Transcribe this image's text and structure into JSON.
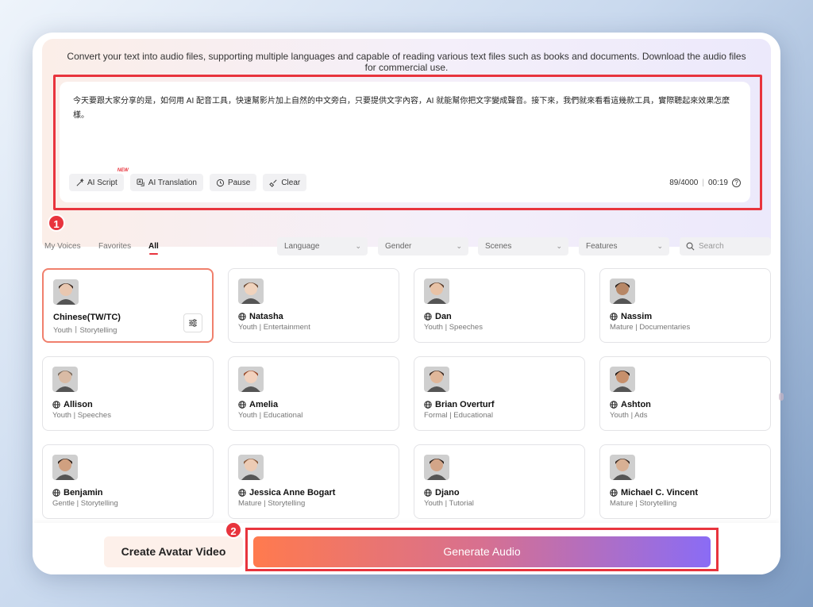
{
  "intro_text": "Convert your text into audio files, supporting multiple languages and capable of reading various text files such as books and documents. Download the audio files for commercial use.",
  "editor": {
    "text": "今天要跟大家分享的是，如何用 AI 配音工具，快速幫影片加上自然的中文旁白，只要提供文字內容，AI 就能幫你把文字變成聲音。接下來，我們就來看看這幾款工具，實際聽起來效果怎麼樣。",
    "tools": [
      {
        "label": "AI Script",
        "icon": "ai-script-icon",
        "badge": "NEW"
      },
      {
        "label": "AI Translation",
        "icon": "translate-icon"
      },
      {
        "label": "Pause",
        "icon": "pause-clock-icon"
      },
      {
        "label": "Clear",
        "icon": "broom-icon"
      }
    ],
    "char_count": "89/4000",
    "duration": "00:19"
  },
  "markers": {
    "one": "1",
    "two": "2"
  },
  "voice_tabs": [
    {
      "label": "My Voices",
      "active": false
    },
    {
      "label": "Favorites",
      "active": false
    },
    {
      "label": "All",
      "active": true
    }
  ],
  "filters": {
    "language": "Language",
    "gender": "Gender",
    "scenes": "Scenes",
    "features": "Features",
    "search_placeholder": "Search"
  },
  "voices": [
    {
      "name": "Chinese(TW/TC)",
      "meta": "Youth丨Storytelling",
      "selected": true,
      "globe": false
    },
    {
      "name": "Natasha",
      "meta": "Youth | Entertainment",
      "selected": false,
      "globe": true
    },
    {
      "name": "Dan",
      "meta": "Youth | Speeches",
      "selected": false,
      "globe": true
    },
    {
      "name": "Nassim",
      "meta": "Mature | Documentaries",
      "selected": false,
      "globe": true
    },
    {
      "name": "Allison",
      "meta": "Youth | Speeches",
      "selected": false,
      "globe": true
    },
    {
      "name": "Amelia",
      "meta": "Youth | Educational",
      "selected": false,
      "globe": true
    },
    {
      "name": "Brian Overturf",
      "meta": "Formal | Educational",
      "selected": false,
      "globe": true
    },
    {
      "name": "Ashton",
      "meta": "Youth | Ads",
      "selected": false,
      "globe": true
    },
    {
      "name": "Benjamin",
      "meta": "Gentle | Storytelling",
      "selected": false,
      "globe": true
    },
    {
      "name": "Jessica Anne Bogart",
      "meta": "Mature | Storytelling",
      "selected": false,
      "globe": true
    },
    {
      "name": "Djano",
      "meta": "Youth | Tutorial",
      "selected": false,
      "globe": true
    },
    {
      "name": "Michael C. Vincent",
      "meta": "Mature | Storytelling",
      "selected": false,
      "globe": true
    }
  ],
  "actions": {
    "create_avatar": "Create Avatar Video",
    "generate_audio": "Generate Audio"
  },
  "colors": {
    "accent_red": "#e8343d",
    "gradient_start": "#ff7a4e",
    "gradient_end": "#8a6cf5"
  }
}
